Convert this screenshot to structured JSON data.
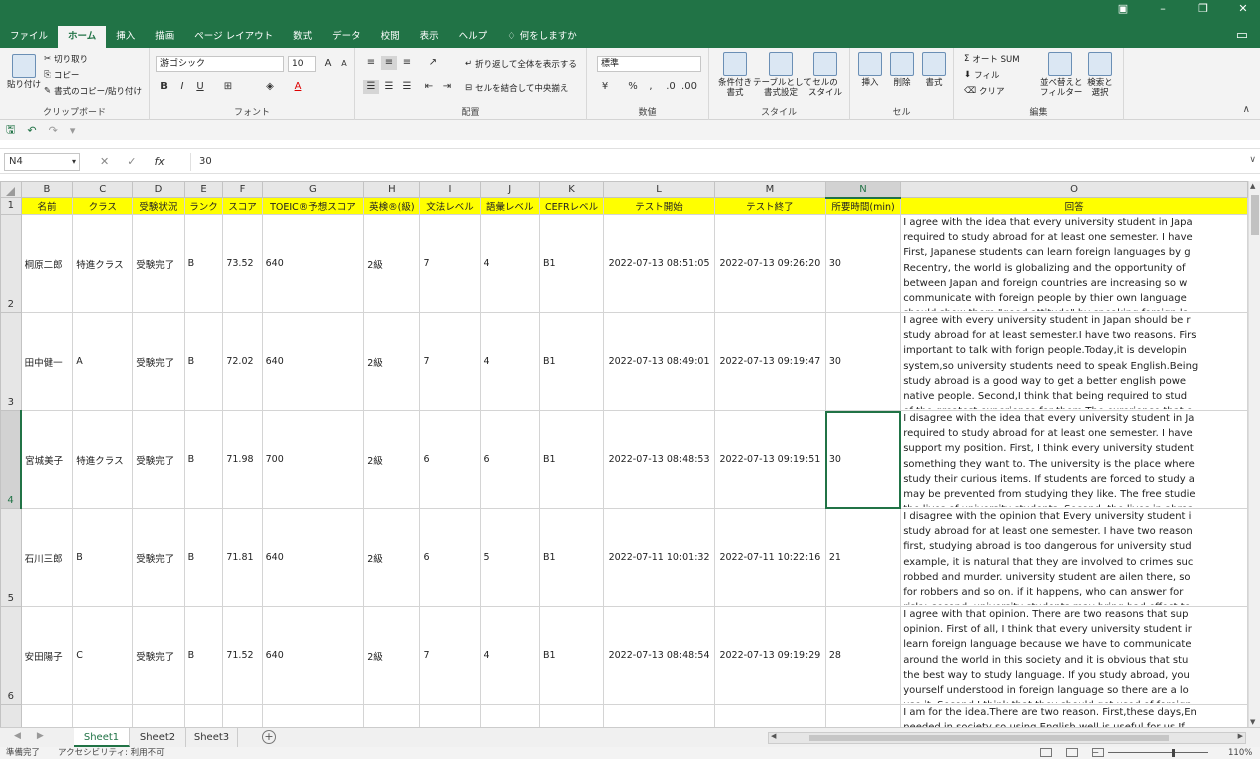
{
  "tabs": [
    "ファイル",
    "ホーム",
    "挿入",
    "描画",
    "ページ レイアウト",
    "数式",
    "データ",
    "校閲",
    "表示",
    "ヘルプ"
  ],
  "tell_me": "何をしますか",
  "ribbon": {
    "clipboard": {
      "label": "クリップボード",
      "paste": "貼り付け",
      "cut": "切り取り",
      "copy": "コピー",
      "format_painter": "書式のコピー/貼り付け"
    },
    "font": {
      "label": "フォント",
      "font_name": "游ゴシック",
      "font_size": "10",
      "bold": "B",
      "italic": "I",
      "underline": "U"
    },
    "alignment": {
      "label": "配置",
      "wrap_text": "折り返して全体を表示する",
      "merge_center": "セルを結合して中央揃え"
    },
    "number": {
      "label": "数値",
      "format": "標準",
      "percent": "%"
    },
    "styles": {
      "label": "スタイル",
      "conditional": "条件付き\n書式",
      "as_table": "テーブルとして\n書式設定",
      "cell_styles": "セルの\nスタイル"
    },
    "cells": {
      "label": "セル",
      "insert": "挿入",
      "delete": "削除",
      "format": "書式"
    },
    "editing": {
      "label": "編集",
      "autosum": "オート SUM",
      "fill": "フィル",
      "clear": "クリア",
      "sort": "並べ替えと\nフィルター",
      "find": "検索と\n選択"
    }
  },
  "formula_bar": {
    "name_box": "N4",
    "formula": "30"
  },
  "columns": [
    "B",
    "C",
    "D",
    "E",
    "F",
    "G",
    "H",
    "I",
    "J",
    "K",
    "L",
    "M",
    "N",
    "O"
  ],
  "selected_column": "N",
  "selected_row": "4",
  "headers": [
    "名前",
    "クラス",
    "受験状況",
    "ランク",
    "スコア",
    "TOEIC®予想スコア",
    "英検®(級)",
    "文法レベル",
    "語彙レベル",
    "CEFRレベル",
    "テスト開始",
    "テスト終了",
    "所要時間(min)",
    "回答"
  ],
  "rows": [
    {
      "num": "2",
      "cells": [
        "桐原二郎",
        "特進クラス",
        "受験完了",
        "B",
        "73.52",
        "640",
        "2級",
        "7",
        "4",
        "B1",
        "2022-07-13 08:51:05",
        "2022-07-13 09:26:20",
        "30"
      ],
      "answer": [
        "I agree with the idea that every university student in Japa",
        "required to study abroad for at least one semester. I have",
        "First, Japanese students can learn foreign languages by g",
        "Recentry, the world is globalizing and the opportunity of",
        "between Japan and foreign countries are increasing so w",
        "communicate with foreign people by thier own language",
        "should show them \"good attitude\" by speaking foreign la"
      ]
    },
    {
      "num": "3",
      "cells": [
        "田中健一",
        "A",
        "受験完了",
        "B",
        "72.02",
        "640",
        "2級",
        "7",
        "4",
        "B1",
        "2022-07-13 08:49:01",
        "2022-07-13 09:19:47",
        "30"
      ],
      "answer": [
        "I agree with every university student in Japan should be r",
        "study abroad for at least semester.I have two reasons. Firs",
        "important to talk with forign people.Today,it is developin",
        "system,so university students need to speak English.Being",
        "study abroad is a good way to get a better english powe",
        "native people. Second,I think that being required to stud",
        "of the greatest experience for them.The exrerience that o"
      ]
    },
    {
      "num": "4",
      "cells": [
        "宮城美子",
        "特進クラス",
        "受験完了",
        "B",
        "71.98",
        "700",
        "2級",
        "6",
        "6",
        "B1",
        "2022-07-13 08:48:53",
        "2022-07-13 09:19:51",
        "30"
      ],
      "answer": [
        "I disagree with the idea that every university student in Ja",
        "required to study abroad for at least one semester. I have",
        "support my position. First, I think every university student",
        "something they want to. The university is the place where",
        "study their curious items. If students are forced to study a",
        "may be prevented from studying they like. The free studie",
        "the lives of university students. Second, the lives in abroa"
      ]
    },
    {
      "num": "5",
      "cells": [
        "石川三郎",
        "B",
        "受験完了",
        "B",
        "71.81",
        "640",
        "2級",
        "6",
        "5",
        "B1",
        "2022-07-11 10:01:32",
        "2022-07-11 10:22:16",
        "21"
      ],
      "answer": [
        "I disagree with the opinion that Every university student i",
        "study abroad for at least one semester. I have two reason",
        "first, studying abroad is too dangerous for university stud",
        "example, it is natural that they are involved to crimes suc",
        "robbed and murder. university student are ailen there, so",
        "for robbers and so on. if it happens, who can answer for",
        "risky. second, university students may bring bad effect to"
      ]
    },
    {
      "num": "6",
      "cells": [
        "安田陽子",
        "C",
        "受験完了",
        "B",
        "71.52",
        "640",
        "2級",
        "7",
        "4",
        "B1",
        "2022-07-13 08:48:54",
        "2022-07-13 09:19:29",
        "28"
      ],
      "answer": [
        "I agree with that opinion. There are two reasons that sup",
        "opinion. First of all, I think that every university student ir",
        "learn foreign language because we have to communicate",
        "around the world in this society and it is obvious that stu",
        "the best way to study language. If you study abroad, you",
        "yourself understood in foreign language so there are a lo",
        "use it. Second,I think that they should get used of foreign"
      ]
    }
  ],
  "partial_row": {
    "answer": [
      "I am for the idea.There are two reason. First,these days,En",
      "needed in society,so using English well is useful for us.If"
    ]
  },
  "sheets": [
    "Sheet1",
    "Sheet2",
    "Sheet3"
  ],
  "status": {
    "ready": "準備完了",
    "accessibility": "アクセシビリティ: 利用不可",
    "zoom": "110%"
  }
}
